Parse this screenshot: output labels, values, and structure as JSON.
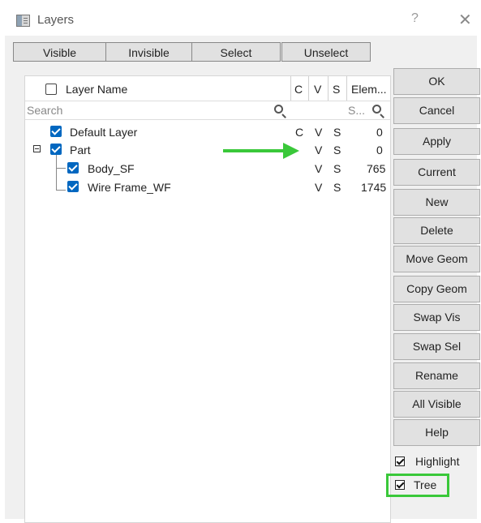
{
  "window": {
    "title": "Layers",
    "help_glyph": "?",
    "close_glyph": "✕"
  },
  "toolbar": {
    "visible": "Visible",
    "invisible": "Invisible",
    "select": "Select",
    "unselect": "Unselect"
  },
  "columns": {
    "name": "Layer Name",
    "c": "C",
    "v": "V",
    "s": "S",
    "elements": "Elem..."
  },
  "search": {
    "placeholder": "Search",
    "s_filter": "S..."
  },
  "layers": [
    {
      "name": "Default Layer",
      "c": "C",
      "v": "V",
      "s": "S",
      "count": "0"
    },
    {
      "name": "Part",
      "c": "",
      "v": "V",
      "s": "S",
      "count": "0"
    },
    {
      "name": "Body_SF",
      "c": "",
      "v": "V",
      "s": "S",
      "count": "765"
    },
    {
      "name": "Wire Frame_WF",
      "c": "",
      "v": "V",
      "s": "S",
      "count": "1745"
    }
  ],
  "buttons": {
    "ok": "OK",
    "cancel": "Cancel",
    "apply": "Apply",
    "current": "Current",
    "new": "New",
    "delete": "Delete",
    "move_geom": "Move Geom",
    "copy_geom": "Copy Geom",
    "swap_vis": "Swap Vis",
    "swap_sel": "Swap Sel",
    "rename": "Rename",
    "all_visible": "All Visible",
    "help": "Help"
  },
  "options": {
    "highlight": "Highlight",
    "tree": "Tree"
  },
  "colors": {
    "accent": "#0067c0",
    "annotation": "#3ac83a"
  },
  "icons": {
    "search": "search-icon",
    "arrow": "arrow-right-icon"
  }
}
